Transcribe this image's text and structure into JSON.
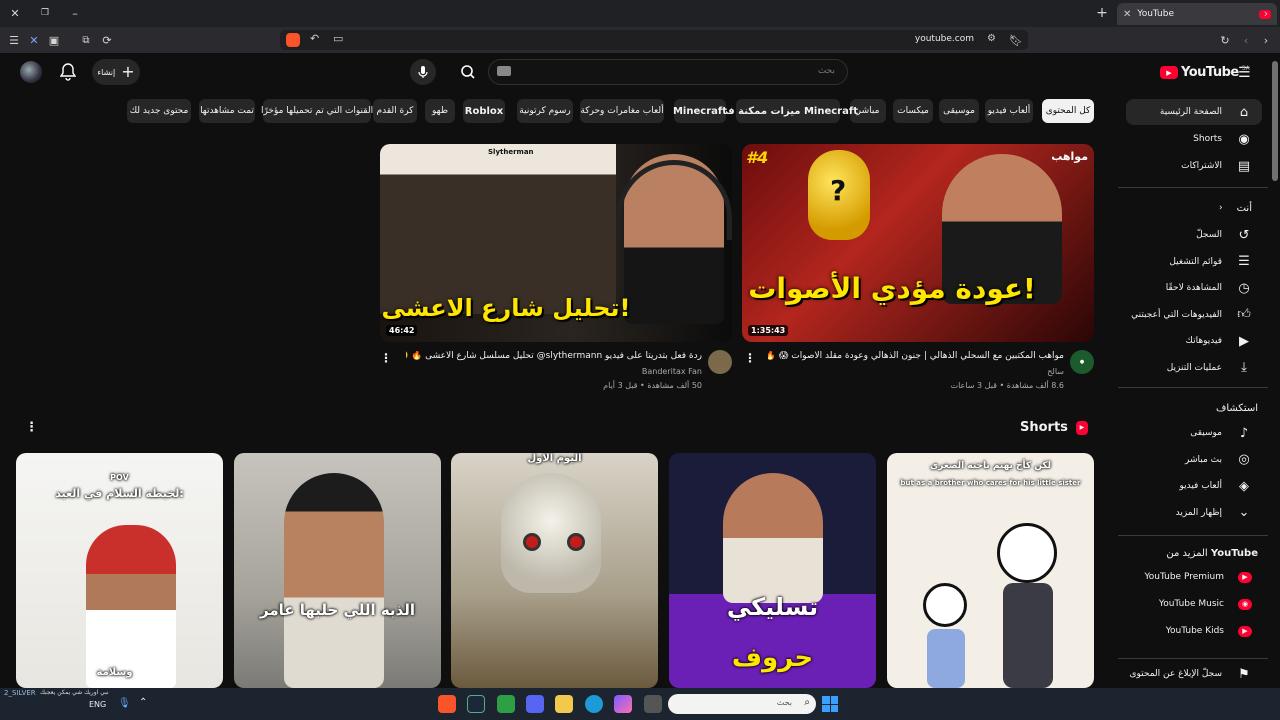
{
  "browser": {
    "tab_title": "YouTube",
    "url": "youtube.com"
  },
  "header": {
    "logo_text": "YouTube",
    "logo_region": "SA",
    "search_placeholder": "بحث",
    "create_label": "إنشاء"
  },
  "chips": [
    "كل المحتوى",
    "ألعاب فيديو",
    "موسيقى",
    "ميكسات",
    "مباشر",
    "ميزات ممكنة في Minecraft",
    "Minecraft",
    "ألعاب مغامرات وحركة",
    "رسوم كرتونية",
    "Roblox",
    "طهو",
    "كرة القدم",
    "القنوات التي تم تحميلها مؤخرًا",
    "تمت مشاهدتها",
    "محتوى جديد لك"
  ],
  "sidebar": {
    "main": [
      {
        "label": "الصفحة الرئيسية",
        "icon": "home-icon"
      },
      {
        "label": "Shorts",
        "icon": "shorts-icon"
      },
      {
        "label": "الاشتراكات",
        "icon": "subscriptions-icon"
      }
    ],
    "you_heading": "أنت",
    "you": [
      {
        "label": "السجلّ",
        "icon": "history-icon"
      },
      {
        "label": "قوائم التشغيل",
        "icon": "playlists-icon"
      },
      {
        "label": "المشاهدة لاحقًا",
        "icon": "clock-icon"
      },
      {
        "label": "الفيديوهات التي أعجبتني",
        "icon": "like-icon"
      },
      {
        "label": "فيديوهاتك",
        "icon": "your-videos-icon"
      },
      {
        "label": "عمليات التنزيل",
        "icon": "download-icon"
      }
    ],
    "explore_heading": "استكشاف",
    "explore": [
      {
        "label": "موسيقى",
        "icon": "music-icon"
      },
      {
        "label": "بث مباشر",
        "icon": "live-icon"
      },
      {
        "label": "ألعاب فيديو",
        "icon": "gaming-icon"
      },
      {
        "label": "إظهار المزيد",
        "icon": "chevron-down-icon"
      }
    ],
    "more_heading_prefix": "المزيد من",
    "more_heading_brand": "YouTube",
    "more": [
      {
        "label": "YouTube Premium",
        "icon": "yt-premium-icon"
      },
      {
        "label": "YouTube Music",
        "icon": "yt-music-icon"
      },
      {
        "label": "YouTube Kids",
        "icon": "yt-kids-icon"
      }
    ],
    "report": {
      "label": "سجلّ الإبلاغ عن المحتوى",
      "icon": "flag-icon"
    }
  },
  "videos": [
    {
      "thumb_text": "عودة مؤدي الأصوات!",
      "badge": "#4",
      "channel_badge": "مواهب",
      "duration": "1:35:43",
      "title": "مواهب المكتبين مع السحلي الذهالي | جنون الذهالي وعودة مقلد الاصوات 😱 🔥 !",
      "channel": "سالح",
      "views": "8.6 ألف مشاهدة",
      "age": "قبل 3 ساعات"
    },
    {
      "thumb_text": "تحليل شارع الاعشى!",
      "thumb_tag_name": "Slytherman",
      "duration": "46:42",
      "title": "ردة فعل بتدريتا على فيديو slythermann@ تحليل مسلسل شارع الأعشى 🔥 😵‍💫",
      "channel": "Banderitax Fan",
      "views": "50 ألف مشاهدة",
      "age": "قبل 3 أيام"
    }
  ],
  "shorts": {
    "heading": "Shorts",
    "items": [
      {
        "top": "لكن كأخ يهتم باخته الصغرى",
        "sub": "but as a brother who cares for his little sister",
        "main": ""
      },
      {
        "top": "",
        "sub": "",
        "main": "تسليكي",
        "main2": "حروف"
      },
      {
        "top": "اليوم الاول",
        "sub": "",
        "main": ""
      },
      {
        "top": "",
        "sub": "",
        "main": "الذبه اللي حلبها عامر"
      },
      {
        "top": "POV",
        "sub": "لخبطة السلام في العيد:",
        "main": "وسلامة"
      }
    ]
  },
  "taskbar": {
    "search_placeholder": "بحث",
    "lang": "ENG",
    "tray_text": "2_SILVER",
    "notice": "نبي اوريك شي يمكن يعجبك"
  }
}
